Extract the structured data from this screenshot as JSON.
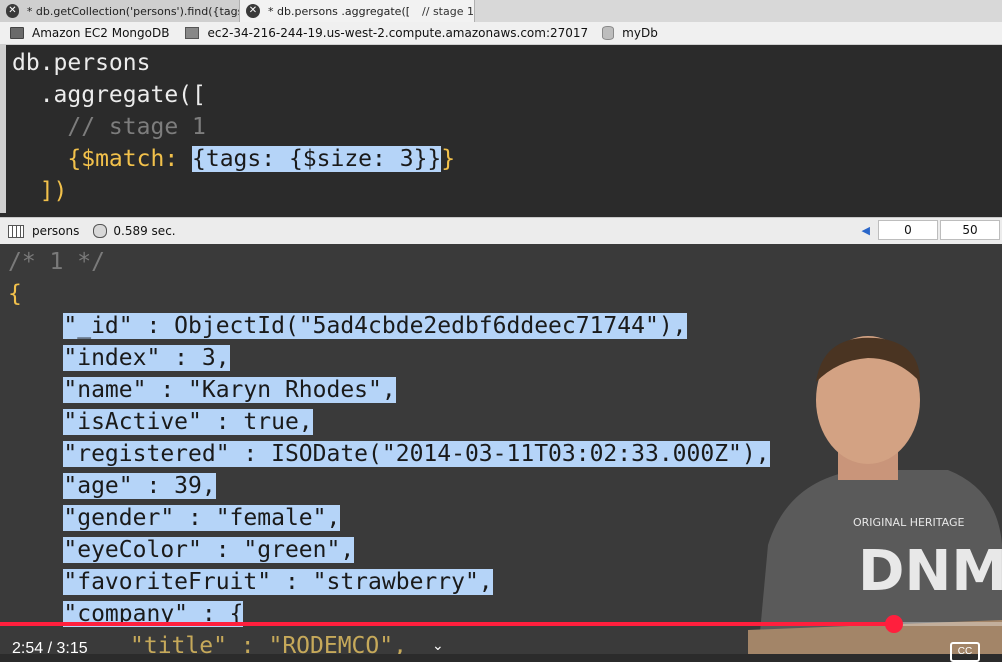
{
  "tabs": [
    {
      "label": "* db.getCollection('persons').find({tags: {",
      "suffix": ""
    },
    {
      "label": "* db.persons  .aggregate([",
      "suffix": "// stage 1"
    }
  ],
  "connection": {
    "server": "Amazon EC2 MongoDB",
    "host": "ec2-34-216-244-19.us-west-2.compute.amazonaws.com:27017",
    "db": "myDb"
  },
  "editor": {
    "lines": [
      {
        "a": "db.persons"
      },
      {
        "a": "  .aggregate(["
      },
      {
        "a": "    // stage 1"
      },
      {
        "a": "    {$match: ",
        "hl": "{tags: {$size: 3}}",
        "b": "}"
      },
      {
        "a": "  ])"
      }
    ]
  },
  "result_bar": {
    "collection": "persons",
    "time": "0.589 sec.",
    "page_start": "0",
    "page_size": "50"
  },
  "results": {
    "comment": "/* 1 */",
    "open_brace": "{",
    "fields": [
      "\"_id\" : ObjectId(\"5ad4cbde2edbf6ddeec71744\"),",
      "\"index\" : 3,",
      "\"name\" : \"Karyn Rhodes\",",
      "\"isActive\" : true,",
      "\"registered\" : ISODate(\"2014-03-11T03:02:33.000Z\"),",
      "\"age\" : 39,",
      "\"gender\" : \"female\",",
      "\"eyeColor\" : \"green\",",
      "\"favoriteFruit\" : \"strawberry\",",
      "\"company\" : {"
    ],
    "next_line": "\"title\" : \"RODEMCO\","
  },
  "shirt_text": {
    "line1": "ORIGINAL HERITAGE",
    "line2": "DNM"
  },
  "video": {
    "time": "2:54 / 3:15",
    "progress": 0.8923,
    "cc_label": "CC",
    "accent": "#ff1f3d"
  }
}
